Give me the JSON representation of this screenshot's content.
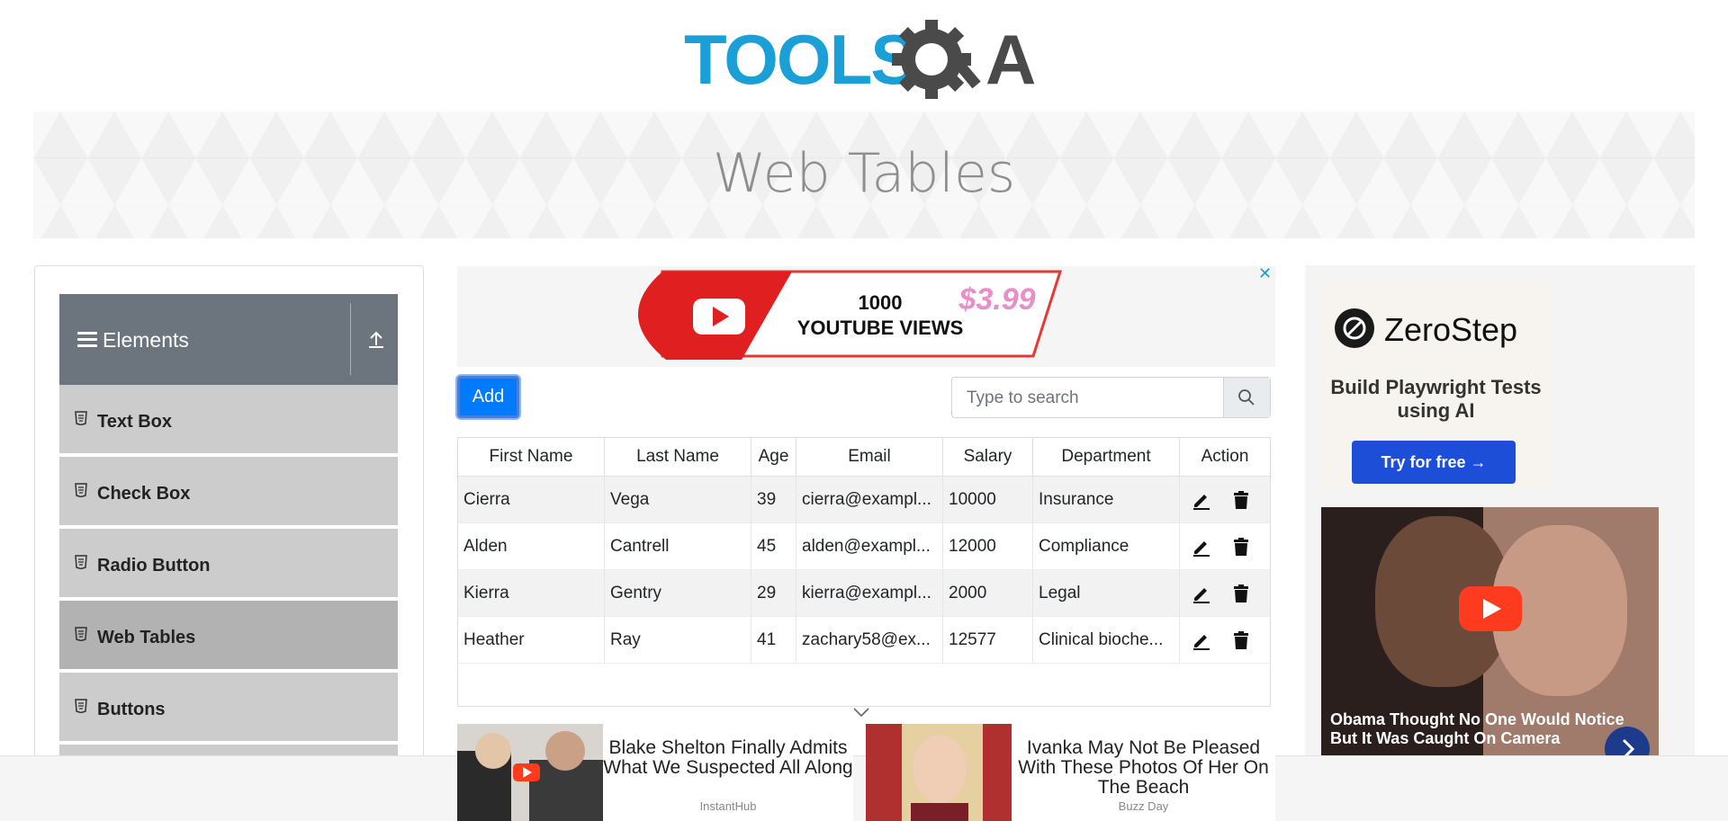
{
  "header": {
    "logo_text": "TOOLSQA"
  },
  "banner": {
    "title": "Web Tables"
  },
  "sidebar": {
    "group_title": "Elements",
    "items": [
      {
        "label": "Text Box"
      },
      {
        "label": "Check Box"
      },
      {
        "label": "Radio Button"
      },
      {
        "label": "Web Tables",
        "active": true
      },
      {
        "label": "Buttons"
      }
    ]
  },
  "toolbar": {
    "add_label": "Add",
    "search_placeholder": "Type to search"
  },
  "table": {
    "columns": [
      "First Name",
      "Last Name",
      "Age",
      "Email",
      "Salary",
      "Department",
      "Action"
    ],
    "rows": [
      [
        "Cierra",
        "Vega",
        "39",
        "cierra@exampl...",
        "10000",
        "Insurance"
      ],
      [
        "Alden",
        "Cantrell",
        "45",
        "alden@exampl...",
        "12000",
        "Compliance"
      ],
      [
        "Kierra",
        "Gentry",
        "29",
        "kierra@exampl...",
        "2000",
        "Legal"
      ],
      [
        "Heather",
        "Ray",
        "41",
        "zachary58@ex...",
        "12577",
        "Clinical bioche..."
      ]
    ]
  },
  "ads": {
    "top_banner": {
      "line1": "1000",
      "line2": "YOUTUBE VIEWS",
      "price": "$3.99"
    },
    "right": {
      "brand": "ZeroStep",
      "tagline": "Build Playwright Tests using AI",
      "cta": "Try for free →",
      "video_caption": "Obama Thought No One Would Notice But It Was Caught On Camera"
    },
    "bottom": [
      {
        "title": "Blake Shelton Finally Admits What We Suspected All Along",
        "source": "InstantHub"
      },
      {
        "title": "Ivanka May Not Be Pleased With These Photos Of Her On The Beach",
        "source": "Buzz Day"
      }
    ]
  },
  "colors": {
    "brand_blue": "#1a9fd6",
    "primary": "#007bff",
    "sidebar_header": "#6c757d"
  }
}
